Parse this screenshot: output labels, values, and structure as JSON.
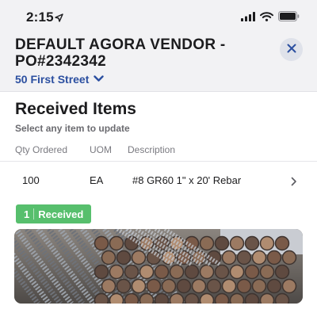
{
  "status_bar": {
    "time": "2:15",
    "icons": [
      "location-arrow-icon",
      "cellular-signal-icon",
      "wifi-icon",
      "battery-icon"
    ]
  },
  "header": {
    "title": "DEFAULT AGORA VENDOR - PO#2342342",
    "address": "50 First Street",
    "close_icon": "close-icon"
  },
  "section": {
    "title": "Received Items",
    "subtitle": "Select any item to update"
  },
  "table": {
    "columns": [
      "Qty Ordered",
      "UOM",
      "Description"
    ],
    "rows": [
      {
        "qty": "100",
        "uom": "EA",
        "description": "#8 GR60 1\" x 20' Rebar"
      }
    ]
  },
  "badge": {
    "count": "1",
    "label": "Received",
    "color": "#57bf6d"
  },
  "photo": {
    "subject": "rebar-bundle-photo"
  },
  "colors": {
    "accent": "#2b4fa0",
    "header_bg": "#f2f2f4",
    "success": "#57bf6d"
  }
}
